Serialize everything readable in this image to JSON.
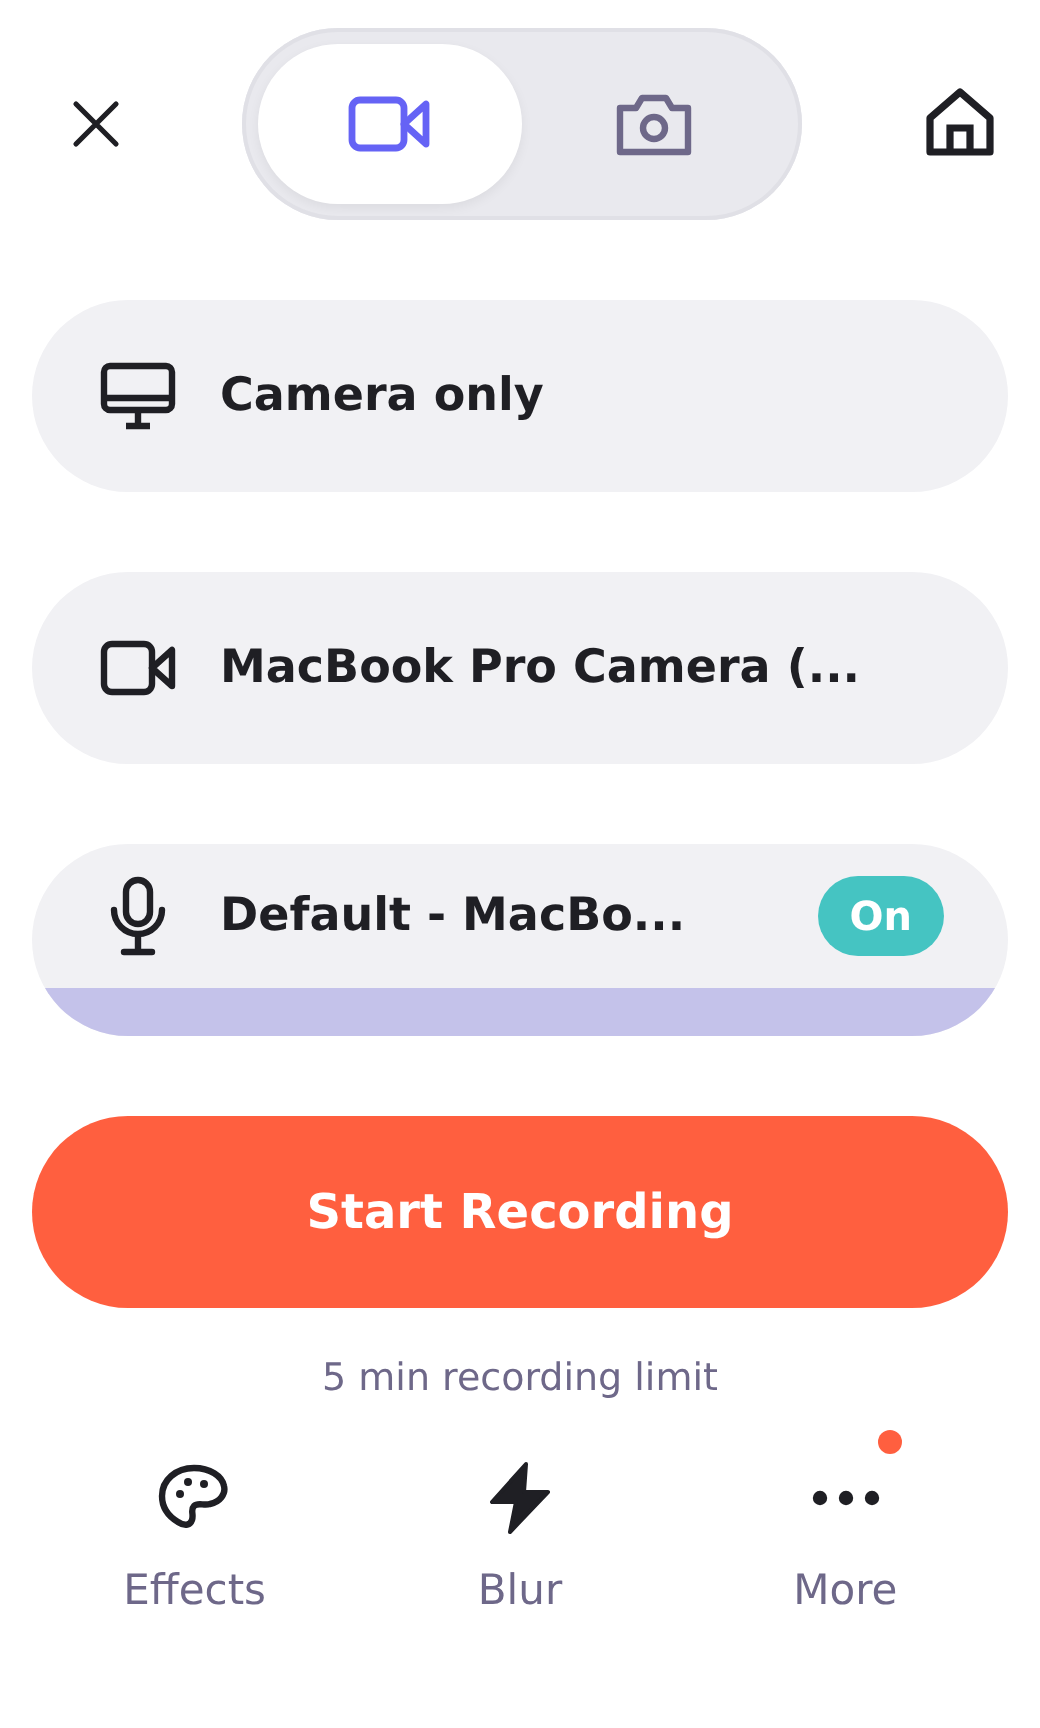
{
  "modes": [
    {
      "kind": "video",
      "selected": true
    },
    {
      "kind": "photo",
      "selected": false
    }
  ],
  "options": [
    {
      "kind": "screen",
      "label": "Camera only"
    },
    {
      "kind": "camera",
      "label": "MacBook Pro Camera (..."
    },
    {
      "kind": "microphone",
      "label": "Default - MacBo...",
      "toggle": {
        "label": "On",
        "on": true
      },
      "level": 1
    }
  ],
  "start_button": "Start Recording",
  "limit_note": "5 min recording limit",
  "tools": [
    {
      "kind": "palette",
      "label": "Effects",
      "badge": false
    },
    {
      "kind": "bolt",
      "label": "Blur",
      "badge": false
    },
    {
      "kind": "dots",
      "label": "More",
      "badge": true
    }
  ]
}
